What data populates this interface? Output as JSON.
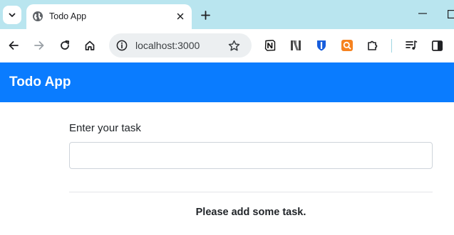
{
  "browser": {
    "tab": {
      "title": "Todo App"
    },
    "address_bar": {
      "url": "localhost:3000"
    },
    "theme_color": "#b9e5ef"
  },
  "icons": {
    "tab_search": "chevron-down-icon",
    "favicon": "globe-icon",
    "tab_close": "close-icon",
    "new_tab": "plus-icon",
    "minimize": "minimize-icon",
    "restore": "restore-icon",
    "back": "arrow-left-icon",
    "forward": "arrow-right-icon",
    "reload": "reload-icon",
    "home": "home-icon",
    "site_info": "info-icon",
    "bookmark": "star-icon",
    "extensions": [
      "notion-icon",
      "n-logo-icon",
      "bitwarden-shield-icon",
      "orange-search-icon",
      "puzzle-icon"
    ],
    "media": "playlist-icon",
    "side_panel": "side-panel-icon"
  },
  "app": {
    "title": "Todo App",
    "brand_color": "#0a7cff",
    "form": {
      "label": "Enter your task",
      "input_value": "",
      "input_placeholder": ""
    },
    "empty_message": "Please add some task."
  }
}
